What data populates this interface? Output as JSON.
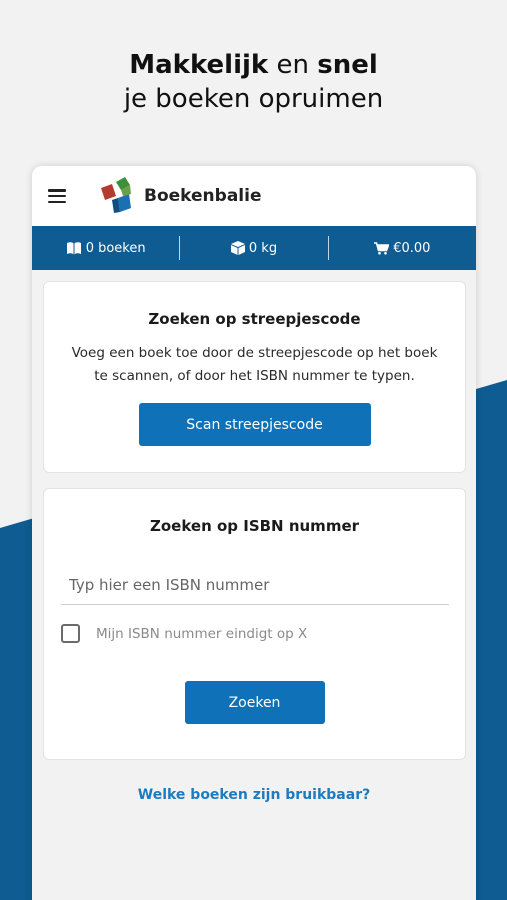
{
  "headline": {
    "bold1": "Makkelijk",
    "mid": "en",
    "bold2": "snel",
    "line2": "je boeken opruimen"
  },
  "app": {
    "brand": "Boekenbalie",
    "colors": {
      "primary": "#0e5c92",
      "button": "#0f71b8",
      "link": "#1c7cc0"
    }
  },
  "status": {
    "books": "0 boeken",
    "weight": "0 kg",
    "price": "€0.00"
  },
  "barcode_card": {
    "title": "Zoeken op streepjescode",
    "description": "Voeg een boek toe door de streepjescode op het boek te scannen, of door het ISBN nummer te typen.",
    "button": "Scan streepjescode"
  },
  "isbn_card": {
    "title": "Zoeken op ISBN nummer",
    "placeholder": "Typ hier een ISBN nummer",
    "checkbox_label": "Mijn ISBN nummer eindigt op X",
    "button": "Zoeken"
  },
  "footer_link": "Welke boeken zijn bruikbaar?"
}
